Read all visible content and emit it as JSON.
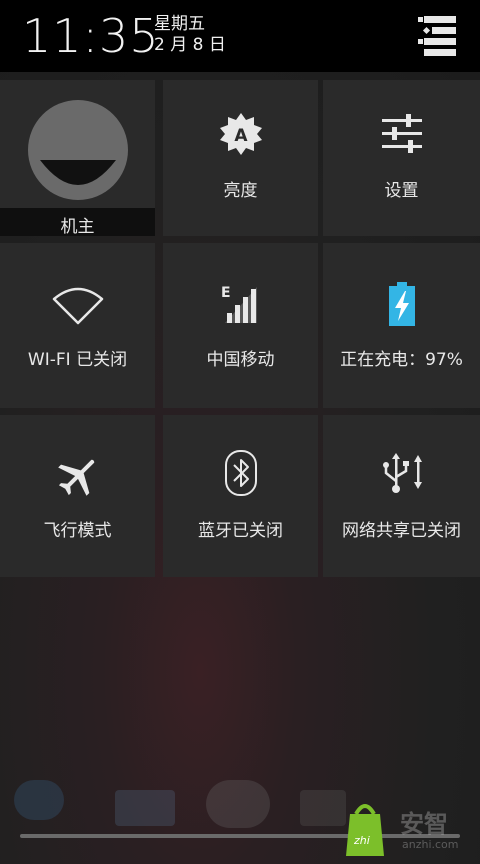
{
  "status": {
    "time": "11:35",
    "weekday": "星期五",
    "date": "2 月 8 日"
  },
  "tiles": {
    "owner": {
      "label": "机主"
    },
    "brightness": {
      "label": "亮度"
    },
    "settings": {
      "label": "设置"
    },
    "wifi": {
      "label": "WI-FI 已关闭"
    },
    "mobile": {
      "label": "中国移动",
      "network_type": "E"
    },
    "battery": {
      "label": "正在充电：97%",
      "percent": 97
    },
    "airplane": {
      "label": "飞行模式"
    },
    "bluetooth": {
      "label": "蓝牙已关闭"
    },
    "tethering": {
      "label": "网络共享已关闭"
    }
  },
  "watermark": {
    "brand": "安智",
    "url": "anzhi.com"
  },
  "colors": {
    "battery_accent": "#33b5e5",
    "tile_bg": "#2a2a2a",
    "header_bg": "#000000"
  }
}
